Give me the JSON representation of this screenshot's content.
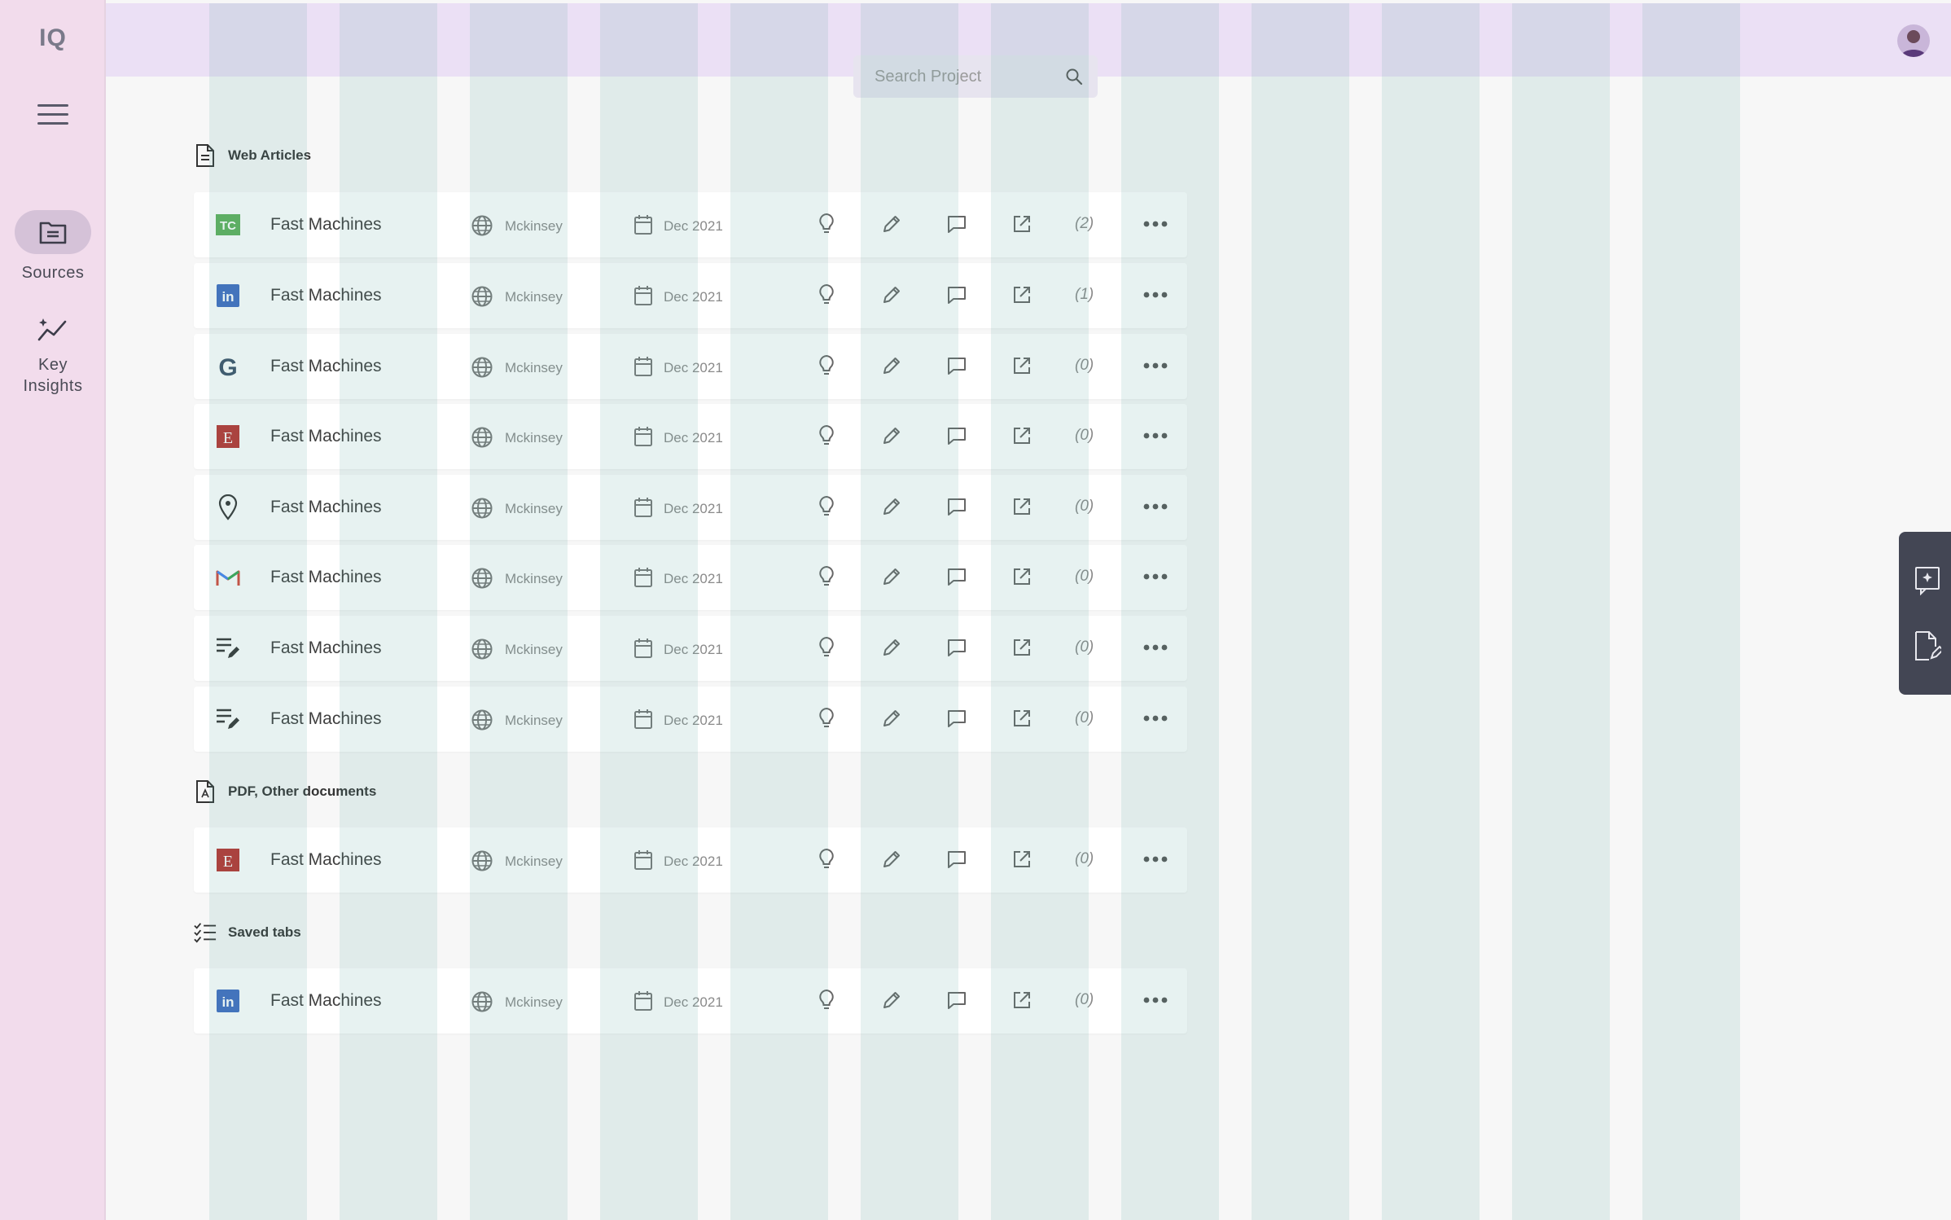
{
  "app": {
    "logo": "IQ"
  },
  "search": {
    "placeholder": "Search Project"
  },
  "nav": [
    {
      "label": "Sources",
      "icon": "folder-icon",
      "active": true
    },
    {
      "label": "Key Insights",
      "icon": "insights-icon",
      "active": false
    }
  ],
  "sections": [
    {
      "title": "Web Articles",
      "icon": "document-icon",
      "rows": [
        {
          "source": "techcrunch",
          "title": "Fast Machines",
          "publisher": "Mckinsey",
          "date": "Dec 2021",
          "count": "(2)"
        },
        {
          "source": "linkedin",
          "title": "Fast Machines",
          "publisher": "Mckinsey",
          "date": "Dec 2021",
          "count": "(1)"
        },
        {
          "source": "google",
          "title": "Fast Machines",
          "publisher": "Mckinsey",
          "date": "Dec 2021",
          "count": "(0)"
        },
        {
          "source": "economist",
          "title": "Fast Machines",
          "publisher": "Mckinsey",
          "date": "Dec 2021",
          "count": "(0)"
        },
        {
          "source": "location",
          "title": "Fast Machines",
          "publisher": "Mckinsey",
          "date": "Dec 2021",
          "count": "(0)"
        },
        {
          "source": "gmail",
          "title": "Fast Machines",
          "publisher": "Mckinsey",
          "date": "Dec 2021",
          "count": "(0)"
        },
        {
          "source": "notes",
          "title": "Fast Machines",
          "publisher": "Mckinsey",
          "date": "Dec 2021",
          "count": "(0)"
        },
        {
          "source": "notes",
          "title": "Fast Machines",
          "publisher": "Mckinsey",
          "date": "Dec 2021",
          "count": "(0)"
        }
      ]
    },
    {
      "title": "PDF, Other documents",
      "icon": "pdf-icon",
      "rows": [
        {
          "source": "economist",
          "title": "Fast Machines",
          "publisher": "Mckinsey",
          "date": "Dec 2021",
          "count": "(0)"
        }
      ]
    },
    {
      "title": "Saved tabs",
      "icon": "checklist-icon",
      "rows": [
        {
          "source": "linkedin",
          "title": "Fast Machines",
          "publisher": "Mckinsey",
          "date": "Dec 2021",
          "count": "(0)"
        }
      ]
    }
  ],
  "colors": {
    "sidebar": "#f2dcec",
    "topbar": "#ebe0f5",
    "panel": "#434654",
    "linkedin": "#3f6cc1",
    "techcrunch": "#5db05a",
    "economist": "#b8322e"
  }
}
